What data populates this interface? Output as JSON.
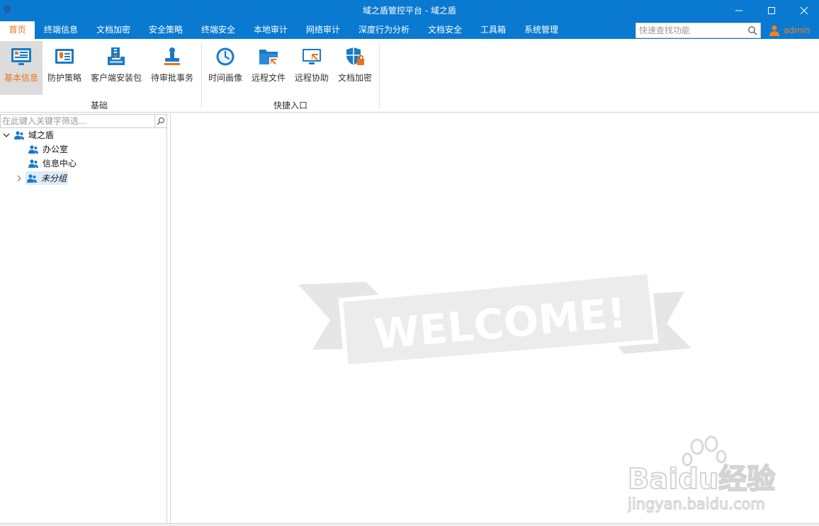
{
  "window": {
    "title": "域之盾管控平台 - 域之盾"
  },
  "menu": {
    "items": [
      "首页",
      "终端信息",
      "文档加密",
      "安全策略",
      "终端安全",
      "本地审计",
      "网络审计",
      "深度行为分析",
      "文档安全",
      "工具箱",
      "系统管理"
    ],
    "active_index": 0,
    "search_placeholder": "快速查找功能",
    "user": "admin"
  },
  "ribbon": {
    "groups": [
      {
        "label": "基础",
        "buttons": [
          {
            "label": "基本信息",
            "icon": "basic-info-icon",
            "active": true
          },
          {
            "label": "防护策略",
            "icon": "policy-icon",
            "active": false
          },
          {
            "label": "客户端安装包",
            "icon": "installer-icon",
            "active": false
          },
          {
            "label": "待审批事务",
            "icon": "approval-stamp-icon",
            "active": false
          }
        ]
      },
      {
        "label": "快捷入口",
        "buttons": [
          {
            "label": "时间画像",
            "icon": "clock-icon",
            "active": false
          },
          {
            "label": "远程文件",
            "icon": "remote-folder-icon",
            "active": false
          },
          {
            "label": "远程协助",
            "icon": "remote-assist-icon",
            "active": false
          },
          {
            "label": "文档加密",
            "icon": "shield-lock-icon",
            "active": false
          }
        ]
      }
    ]
  },
  "tree": {
    "filter_placeholder": "在此键入关键字筛选...",
    "root": "域之盾",
    "children": [
      "办公室",
      "信息中心",
      "未分组"
    ],
    "selected": "未分组"
  },
  "main": {
    "banner_text": "WELCOME!"
  },
  "watermark": {
    "brand": "Baidu经验",
    "url": "jingyan.baidu.com"
  },
  "colors": {
    "titlebar": "#0a79d0",
    "accent": "#e8731a",
    "icon_blue": "#1a7ac8",
    "icon_orange": "#e8731a"
  }
}
